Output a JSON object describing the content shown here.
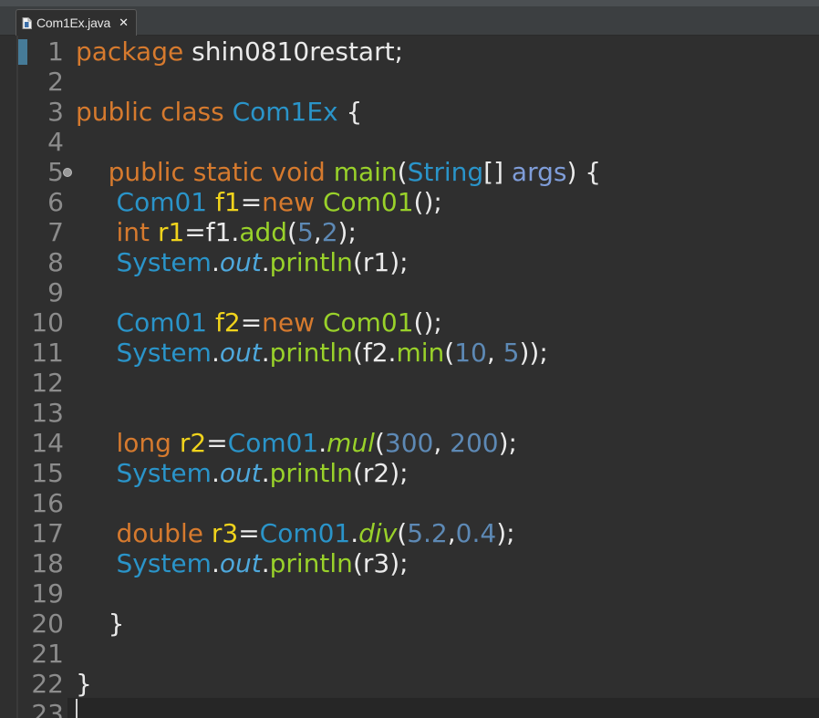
{
  "tab": {
    "label": "Com1Ex.java",
    "close_glyph": "✕"
  },
  "gutter": {
    "line_numbers": [
      "1",
      "2",
      "3",
      "4",
      "5",
      "6",
      "7",
      "8",
      "9",
      "10",
      "11",
      "12",
      "13",
      "14",
      "15",
      "16",
      "17",
      "18",
      "19",
      "20",
      "21",
      "22",
      "23"
    ]
  },
  "code": {
    "lines": [
      [
        {
          "t": "package",
          "c": "kw"
        },
        {
          "t": " shin0810restart;",
          "c": "plain"
        }
      ],
      [],
      [
        {
          "t": "public class ",
          "c": "kw"
        },
        {
          "t": "Com1Ex",
          "c": "typ"
        },
        {
          "t": " {",
          "c": "plain"
        }
      ],
      [],
      [
        {
          "t": "    public static void ",
          "c": "kw"
        },
        {
          "t": "main",
          "c": "fn"
        },
        {
          "t": "(",
          "c": "plain"
        },
        {
          "t": "String",
          "c": "typ"
        },
        {
          "t": "[] ",
          "c": "plain"
        },
        {
          "t": "args",
          "c": "arg"
        },
        {
          "t": ") {",
          "c": "plain"
        }
      ],
      [
        {
          "t": "     ",
          "c": "plain"
        },
        {
          "t": "Com01",
          "c": "typ"
        },
        {
          "t": " ",
          "c": "plain"
        },
        {
          "t": "f1",
          "c": "var"
        },
        {
          "t": "=",
          "c": "plain"
        },
        {
          "t": "new",
          "c": "kw"
        },
        {
          "t": " ",
          "c": "plain"
        },
        {
          "t": "Com01",
          "c": "fn"
        },
        {
          "t": "();",
          "c": "plain"
        }
      ],
      [
        {
          "t": "     ",
          "c": "plain"
        },
        {
          "t": "int",
          "c": "kw"
        },
        {
          "t": " ",
          "c": "plain"
        },
        {
          "t": "r1",
          "c": "var"
        },
        {
          "t": "=f1.",
          "c": "plain"
        },
        {
          "t": "add",
          "c": "fn"
        },
        {
          "t": "(",
          "c": "plain"
        },
        {
          "t": "5",
          "c": "num"
        },
        {
          "t": ",",
          "c": "plain"
        },
        {
          "t": "2",
          "c": "num"
        },
        {
          "t": ");",
          "c": "plain"
        }
      ],
      [
        {
          "t": "     ",
          "c": "plain"
        },
        {
          "t": "System",
          "c": "typ"
        },
        {
          "t": ".",
          "c": "plain"
        },
        {
          "t": "out",
          "c": "sfield"
        },
        {
          "t": ".",
          "c": "plain"
        },
        {
          "t": "println",
          "c": "fn"
        },
        {
          "t": "(r1);",
          "c": "plain"
        }
      ],
      [],
      [
        {
          "t": "     ",
          "c": "plain"
        },
        {
          "t": "Com01",
          "c": "typ"
        },
        {
          "t": " ",
          "c": "plain"
        },
        {
          "t": "f2",
          "c": "var"
        },
        {
          "t": "=",
          "c": "plain"
        },
        {
          "t": "new",
          "c": "kw"
        },
        {
          "t": " ",
          "c": "plain"
        },
        {
          "t": "Com01",
          "c": "fn"
        },
        {
          "t": "();",
          "c": "plain"
        }
      ],
      [
        {
          "t": "     ",
          "c": "plain"
        },
        {
          "t": "System",
          "c": "typ"
        },
        {
          "t": ".",
          "c": "plain"
        },
        {
          "t": "out",
          "c": "sfield"
        },
        {
          "t": ".",
          "c": "plain"
        },
        {
          "t": "println",
          "c": "fn"
        },
        {
          "t": "(f2.",
          "c": "plain"
        },
        {
          "t": "min",
          "c": "fn"
        },
        {
          "t": "(",
          "c": "plain"
        },
        {
          "t": "10",
          "c": "num"
        },
        {
          "t": ", ",
          "c": "plain"
        },
        {
          "t": "5",
          "c": "num"
        },
        {
          "t": "));",
          "c": "plain"
        }
      ],
      [],
      [],
      [
        {
          "t": "     ",
          "c": "plain"
        },
        {
          "t": "long",
          "c": "kw"
        },
        {
          "t": " ",
          "c": "plain"
        },
        {
          "t": "r2",
          "c": "var"
        },
        {
          "t": "=",
          "c": "plain"
        },
        {
          "t": "Com01",
          "c": "typ"
        },
        {
          "t": ".",
          "c": "plain"
        },
        {
          "t": "mul",
          "c": "smeth"
        },
        {
          "t": "(",
          "c": "plain"
        },
        {
          "t": "300",
          "c": "num"
        },
        {
          "t": ", ",
          "c": "plain"
        },
        {
          "t": "200",
          "c": "num"
        },
        {
          "t": ");",
          "c": "plain"
        }
      ],
      [
        {
          "t": "     ",
          "c": "plain"
        },
        {
          "t": "System",
          "c": "typ"
        },
        {
          "t": ".",
          "c": "plain"
        },
        {
          "t": "out",
          "c": "sfield"
        },
        {
          "t": ".",
          "c": "plain"
        },
        {
          "t": "println",
          "c": "fn"
        },
        {
          "t": "(r2);",
          "c": "plain"
        }
      ],
      [],
      [
        {
          "t": "     ",
          "c": "plain"
        },
        {
          "t": "double",
          "c": "kw"
        },
        {
          "t": " ",
          "c": "plain"
        },
        {
          "t": "r3",
          "c": "var"
        },
        {
          "t": "=",
          "c": "plain"
        },
        {
          "t": "Com01",
          "c": "typ"
        },
        {
          "t": ".",
          "c": "plain"
        },
        {
          "t": "div",
          "c": "smeth"
        },
        {
          "t": "(",
          "c": "plain"
        },
        {
          "t": "5.2",
          "c": "num"
        },
        {
          "t": ",",
          "c": "plain"
        },
        {
          "t": "0.4",
          "c": "num"
        },
        {
          "t": ");",
          "c": "plain"
        }
      ],
      [
        {
          "t": "     ",
          "c": "plain"
        },
        {
          "t": "System",
          "c": "typ"
        },
        {
          "t": ".",
          "c": "plain"
        },
        {
          "t": "out",
          "c": "sfield"
        },
        {
          "t": ".",
          "c": "plain"
        },
        {
          "t": "println",
          "c": "fn"
        },
        {
          "t": "(r3);",
          "c": "plain"
        }
      ],
      [],
      [
        {
          "t": "    }",
          "c": "plain"
        }
      ],
      [],
      [
        {
          "t": "}",
          "c": "plain"
        }
      ],
      []
    ]
  },
  "colors": {
    "keyword": "#d67a2e",
    "type": "#2a94c9",
    "method": "#99d12a",
    "number": "#5d89b5",
    "variable": "#f0d31c",
    "parameter": "#7f9dd9",
    "text": "#eaeaea",
    "line_number": "#8c8c8c",
    "background": "#2f2f2f"
  },
  "icons": {
    "file": "java-file-icon",
    "close": "close-icon",
    "fold": "fold-collapse-icon"
  }
}
